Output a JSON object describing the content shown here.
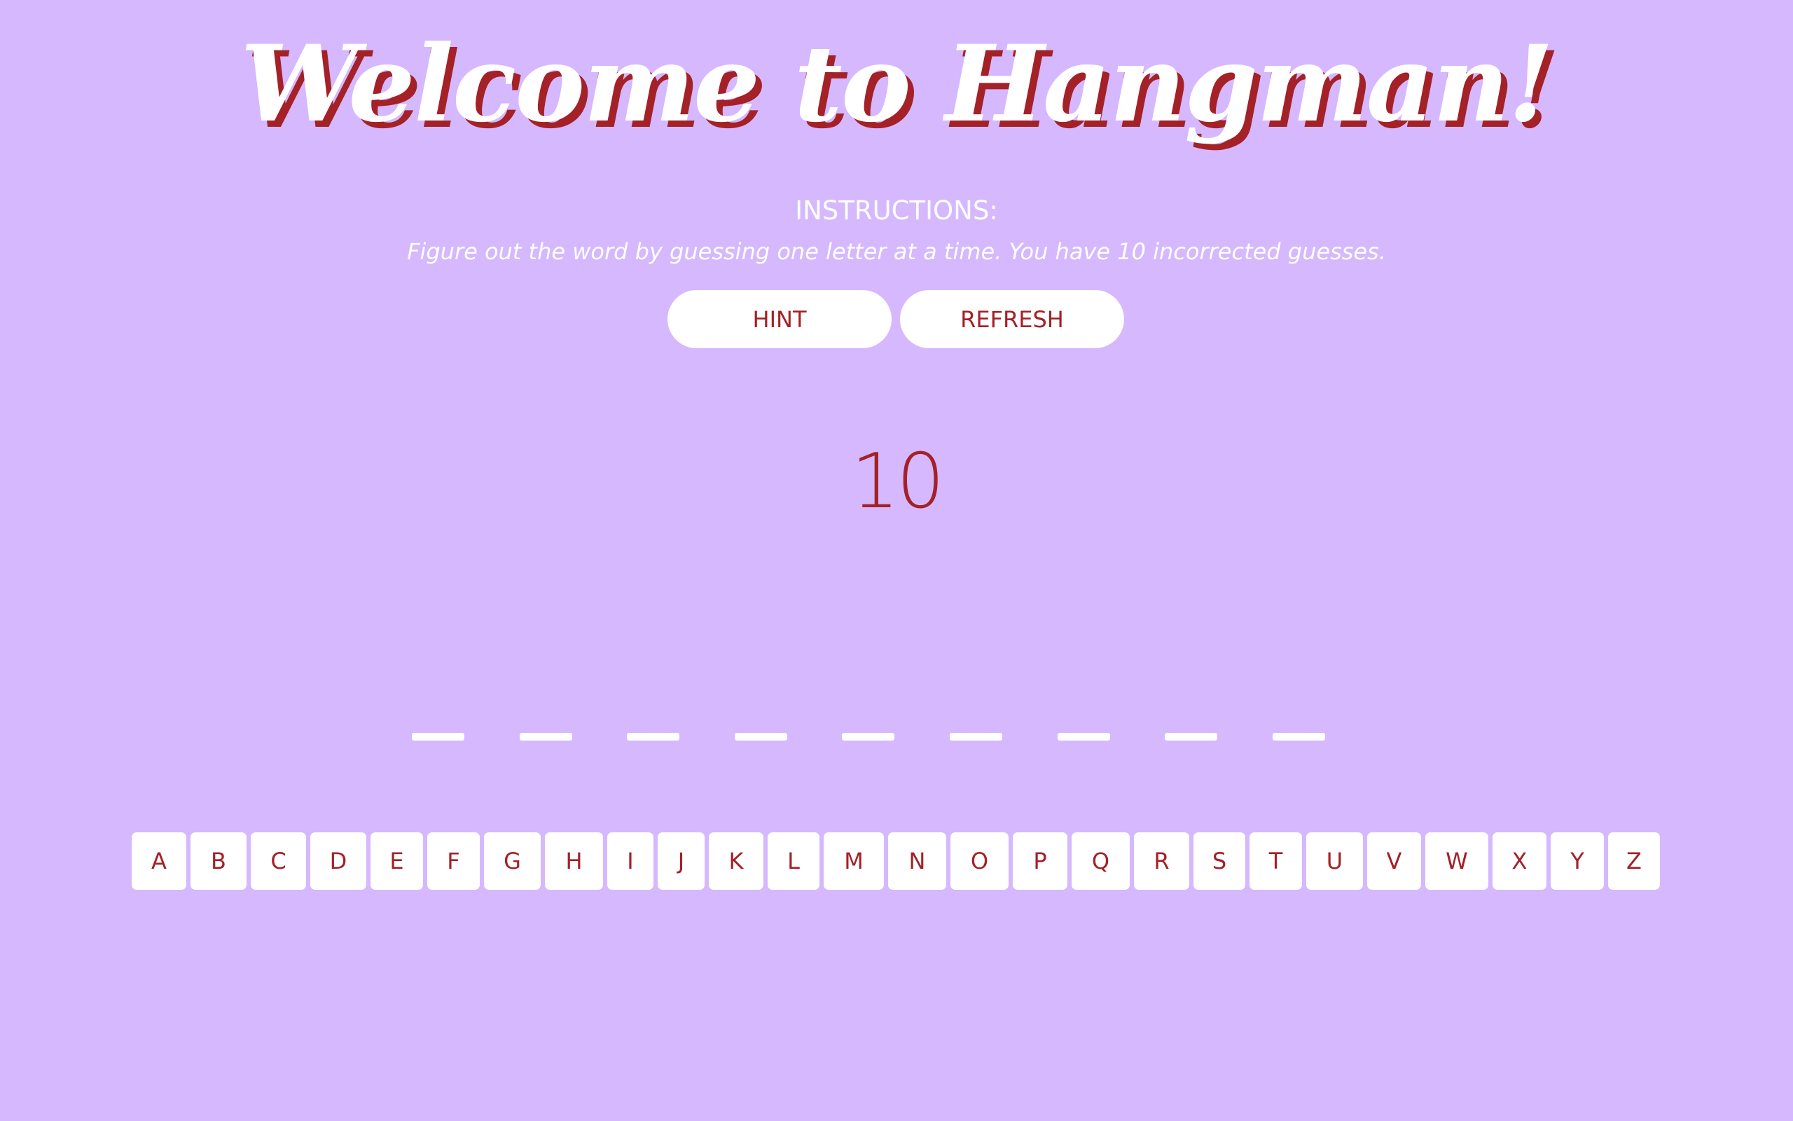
{
  "page": {
    "title": "Welcome to Hangman!",
    "background_color": "#d5b8fd",
    "accent_color": "#a32127"
  },
  "instructions": {
    "heading": "INSTRUCTIONS:",
    "text": "Figure out the word by guessing one letter at a time. You have 10 incorrected guesses."
  },
  "buttons": {
    "hint": "HINT",
    "refresh": "REFRESH"
  },
  "game": {
    "guesses_remaining": "10",
    "word_blanks": [
      "",
      "",
      "",
      "",
      "",
      "",
      "",
      "",
      ""
    ]
  },
  "keyboard": {
    "letters": [
      "A",
      "B",
      "C",
      "D",
      "E",
      "F",
      "G",
      "H",
      "I",
      "J",
      "K",
      "L",
      "M",
      "N",
      "O",
      "P",
      "Q",
      "R",
      "S",
      "T",
      "U",
      "V",
      "W",
      "X",
      "Y",
      "Z"
    ]
  }
}
